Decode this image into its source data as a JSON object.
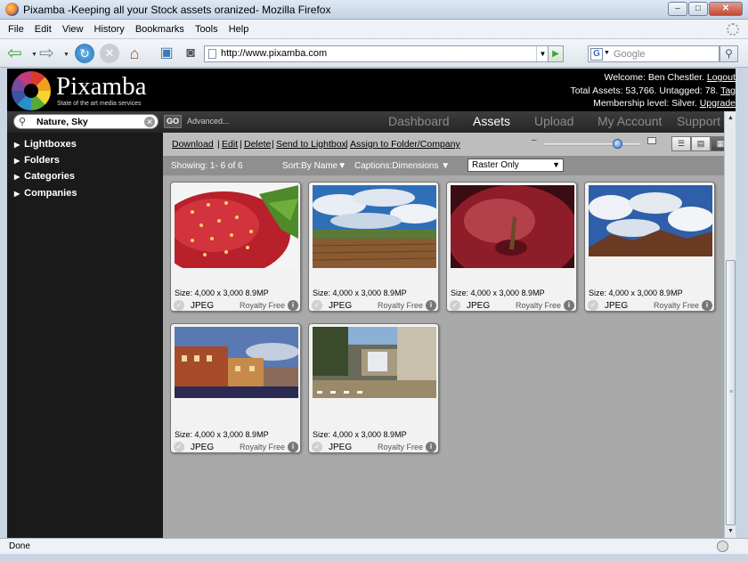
{
  "window": {
    "title": "Pixamba -Keeping all your  Stock assets oranized- Mozilla Firefox",
    "minimize": "–",
    "maximize": "□",
    "close": "✕"
  },
  "menu": [
    "File",
    "Edit",
    "View",
    "History",
    "Bookmarks",
    "Tools",
    "Help"
  ],
  "toolbar": {
    "url": "http://www.pixamba.com",
    "search_placeholder": "Google"
  },
  "brand": {
    "name": "Pixamba",
    "tagline": "State of the art media services"
  },
  "user": {
    "welcome": "Welcome: Ben Chestler.",
    "logout": "Logout",
    "assets": "Total Assets: 53,766. Untagged: 78.",
    "tag": "Tag",
    "membership": "Membership level: Silver.",
    "upgrade": "Upgrade"
  },
  "search": {
    "value": "Nature, Sky",
    "go": "GO",
    "advanced": "Advanced..."
  },
  "nav_tabs": [
    "Dashboard",
    "Assets",
    "Upload",
    "My Account",
    "Support"
  ],
  "active_tab": "Assets",
  "sidebar": [
    "Lightboxes",
    "Folders",
    "Categories",
    "Companies"
  ],
  "actions": [
    "Download",
    "Edit",
    "Delete",
    "Send to Lightbox",
    "Assign to Folder/Company"
  ],
  "filters": {
    "showing": "Showing: 1- 6 of 6",
    "sort": "Sort:By Name",
    "captions": "Captions:Dimensions",
    "type": "Raster Only"
  },
  "zoom_level": 0.76,
  "assets": [
    {
      "subject": "strawberry",
      "size": "Size: 4,000 x 3,000 8.9MP",
      "type": "JPEG",
      "license": "Royalty Free"
    },
    {
      "subject": "landscape-clouds",
      "size": "Size: 4,000 x 3,000 8.9MP",
      "type": "JPEG",
      "license": "Royalty Free"
    },
    {
      "subject": "apple",
      "size": "Size: 4,000 x 3,000 8.9MP",
      "type": "JPEG",
      "license": "Royalty Free"
    },
    {
      "subject": "desert-sky",
      "size": "Size: 4,000 x 3,000 8.9MP",
      "type": "JPEG",
      "license": "Royalty Free"
    },
    {
      "subject": "houses",
      "size": "Size: 4,000 x 3,000 8.9MP",
      "type": "JPEG",
      "license": "Royalty Free"
    },
    {
      "subject": "car-alley",
      "size": "Size: 4,000 x 3,000 8.9MP",
      "type": "JPEG",
      "license": "Royalty Free"
    }
  ],
  "status": "Done"
}
